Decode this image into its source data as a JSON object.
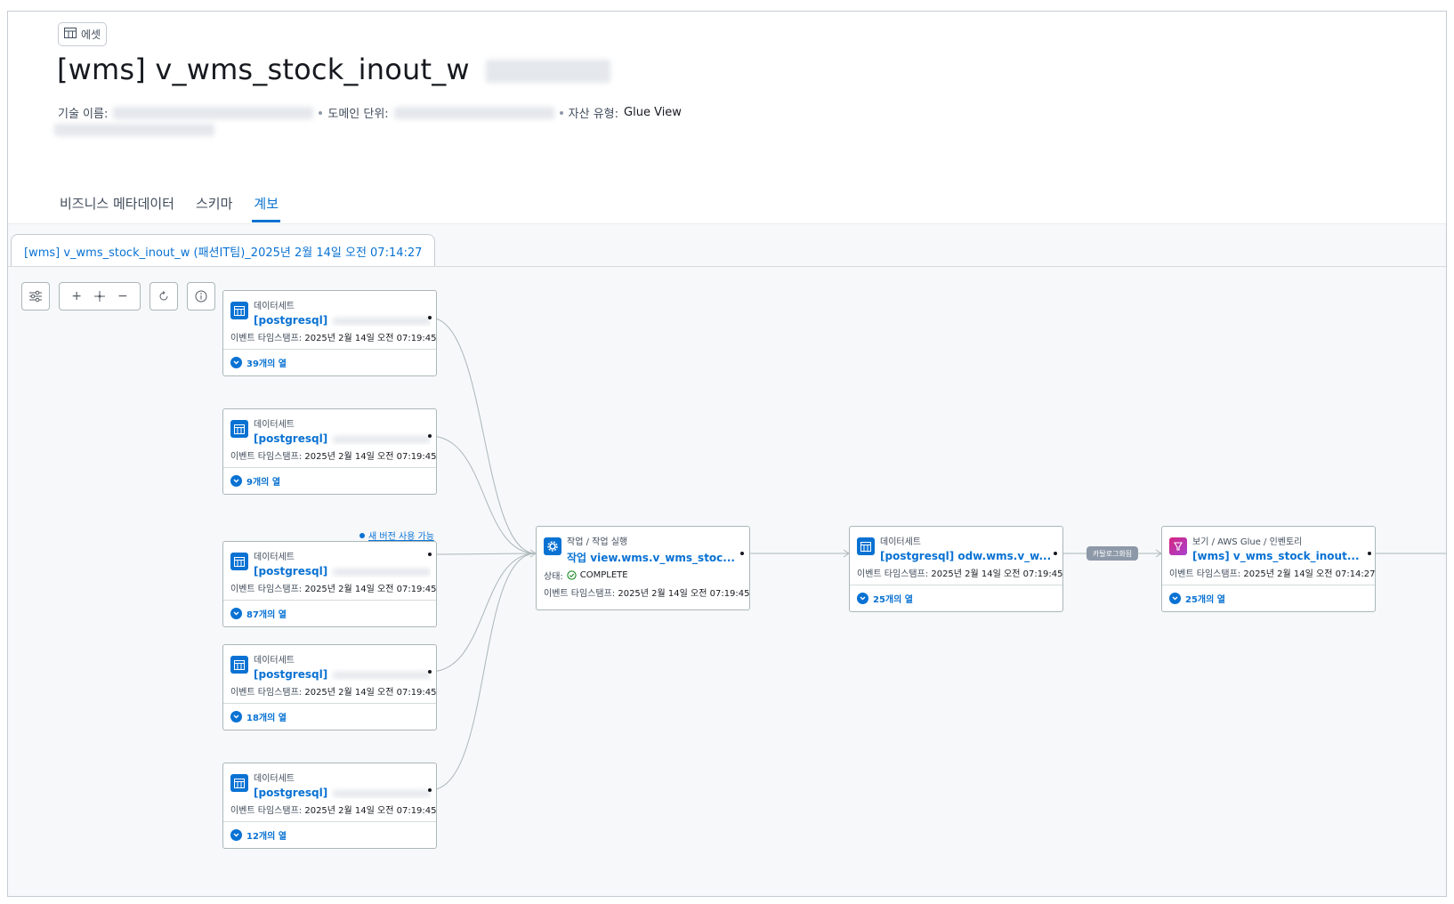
{
  "asset_badge": {
    "label": "에셋",
    "icon": "table-icon"
  },
  "title": "[wms] v_wms_stock_inout_w",
  "meta": {
    "technical_name_label": "기술 이름:",
    "domain_unit_label": "도메인 단위:",
    "asset_type_label": "자산 유형:",
    "asset_type_value": "Glue View"
  },
  "tabs": [
    "비즈니스 메타데이터",
    "스키마",
    "계보"
  ],
  "active_tab": "계보",
  "version_tab": "[wms] v_wms_stock_inout_w (패션IT팀)_2025년 2월 14일 오전 07:14:27",
  "toolbar": {
    "settings_icon": "sliders-icon",
    "zoom_in": "+",
    "zoom_out": "−",
    "fit_icon": "move-icon",
    "reset_icon": "refresh-icon",
    "info_icon": "info-icon"
  },
  "nodes": {
    "sources": [
      {
        "kind": "데이터세트",
        "name": "[postgresql]",
        "ts_label": "이벤트 타임스탬프:",
        "ts": "2025년 2월 14일 오전 07:19:45",
        "cols": "39개의 열"
      },
      {
        "kind": "데이터세트",
        "name": "[postgresql]",
        "ts_label": "이벤트 타임스탬프:",
        "ts": "2025년 2월 14일 오전 07:19:45",
        "cols": "9개의 열"
      },
      {
        "kind": "데이터세트",
        "name": "[postgresql]",
        "ts_label": "이벤트 타임스탬프:",
        "ts": "2025년 2월 14일 오전 07:19:45",
        "cols": "87개의 열"
      },
      {
        "kind": "데이터세트",
        "name": "[postgresql]",
        "ts_label": "이벤트 타임스탬프:",
        "ts": "2025년 2월 14일 오전 07:19:45",
        "cols": "18개의 열"
      },
      {
        "kind": "데이터세트",
        "name": "[postgresql]",
        "ts_label": "이벤트 타임스탬프:",
        "ts": "2025년 2월 14일 오전 07:19:45",
        "cols": "12개의 열"
      }
    ],
    "new_version": "새 버전 사용 가능",
    "job": {
      "kind": "작업 / 작업 실행",
      "name": "작업 view.wms.v_wms_stoc...",
      "status_label": "상태:",
      "status": "COMPLETE",
      "ts_label": "이벤트 타임스탬프:",
      "ts": "2025년 2월 14일 오전 07:19:45"
    },
    "output": {
      "kind": "데이터세트",
      "name": "[postgresql] odw.wms.v_w...",
      "ts_label": "이벤트 타임스탬프:",
      "ts": "2025년 2월 14일 오전 07:19:45",
      "cols": "25개의 열"
    },
    "catalog_pill": "카탈로그화됨",
    "view": {
      "kind": "보기 / AWS Glue / 인벤토리",
      "name": "[wms] v_wms_stock_inout...",
      "ts_label": "이벤트 타임스탬프:",
      "ts": "2025년 2월 14일 오전 07:14:27",
      "cols": "25개의 열"
    }
  },
  "colors": {
    "accent": "#0972d3",
    "success": "#037f0c",
    "glue": "#c925d1"
  }
}
